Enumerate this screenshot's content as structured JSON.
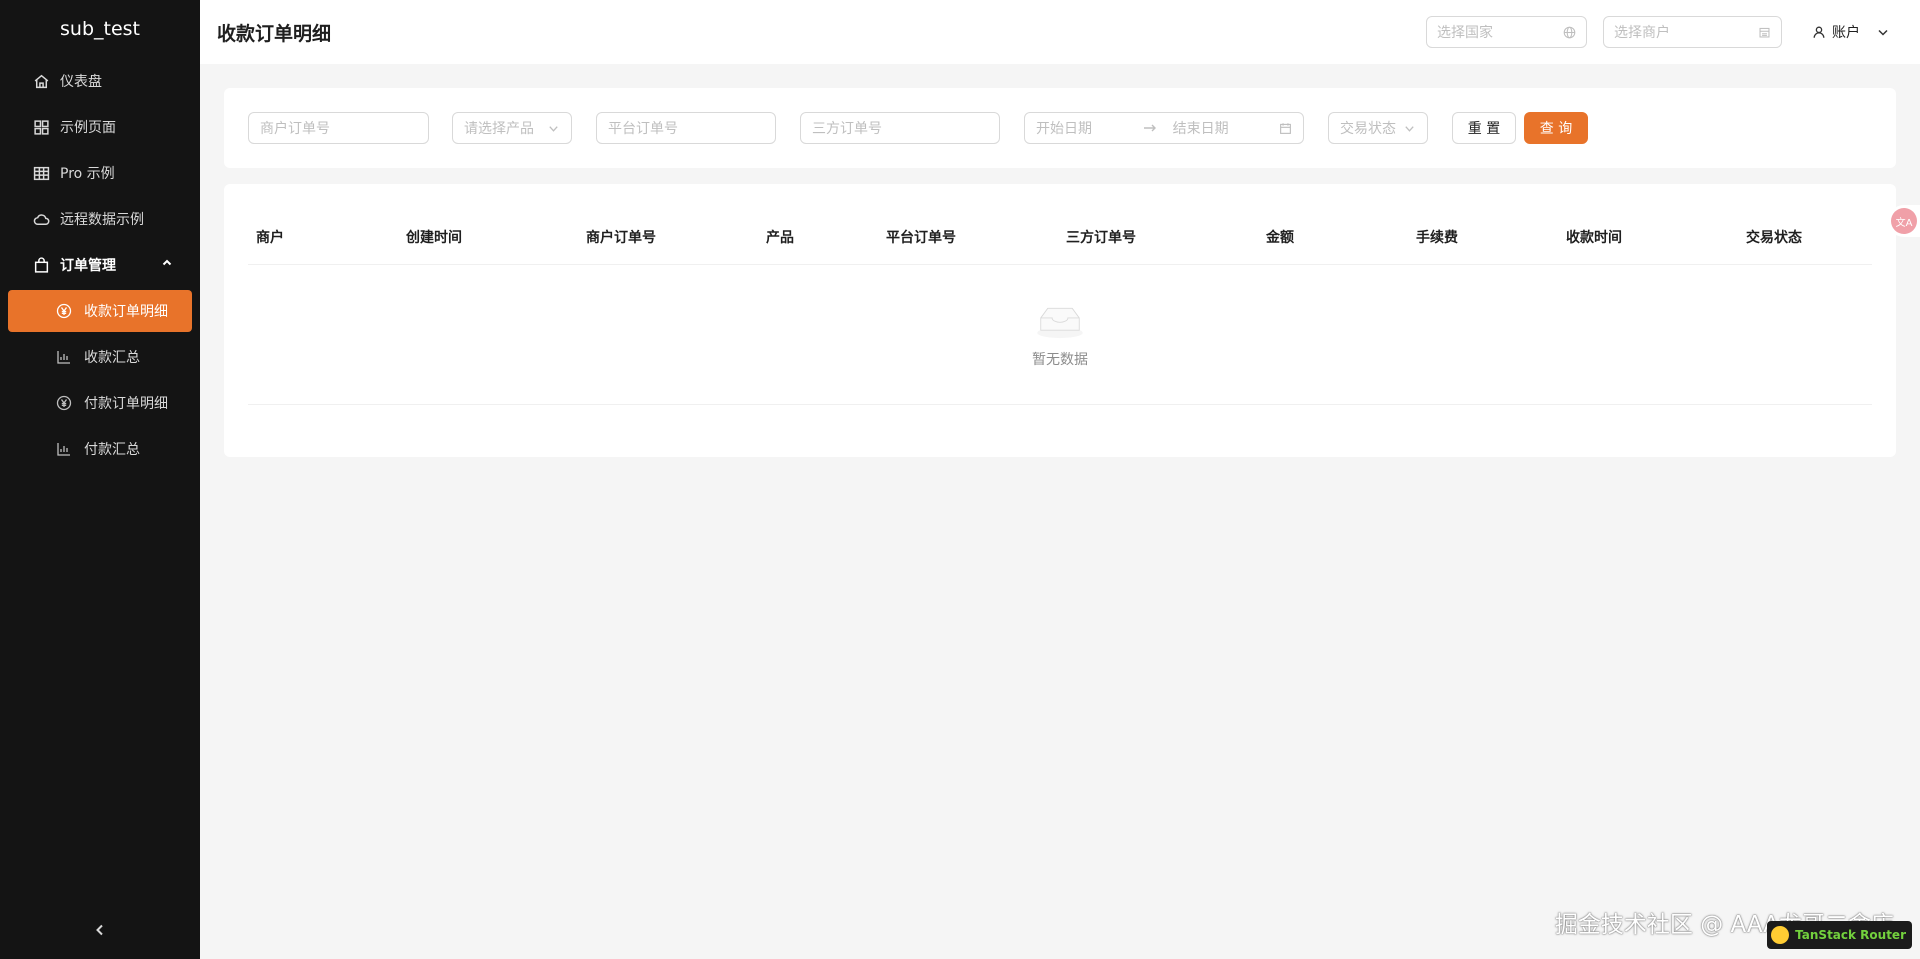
{
  "sidebar": {
    "brand": "sub_test",
    "items": [
      {
        "label": "仪表盘",
        "icon": "home-icon"
      },
      {
        "label": "示例页面",
        "icon": "grid-icon"
      },
      {
        "label": "Pro 示例",
        "icon": "table-icon"
      },
      {
        "label": "远程数据示例",
        "icon": "cloud-icon"
      }
    ],
    "group": {
      "label": "订单管理",
      "icon": "shopping-bag-icon"
    },
    "sub_items": [
      {
        "label": "收款订单明细",
        "icon": "yen-circle-icon",
        "active": true
      },
      {
        "label": "收款汇总",
        "icon": "bar-chart-icon"
      },
      {
        "label": "付款订单明细",
        "icon": "yen-circle-icon"
      },
      {
        "label": "付款汇总",
        "icon": "bar-chart-icon"
      }
    ]
  },
  "header": {
    "title": "收款订单明细",
    "country_placeholder": "选择国家",
    "merchant_placeholder": "选择商户",
    "account_label": "账户"
  },
  "filters": {
    "merchant_order_no": "商户订单号",
    "product": "请选择产品",
    "platform_order_no": "平台订单号",
    "third_party_order_no": "三方订单号",
    "start_date": "开始日期",
    "end_date": "结束日期",
    "trade_status": "交易状态",
    "reset_label": "重 置",
    "query_label": "查 询"
  },
  "table": {
    "columns": [
      "商户",
      "创建时间",
      "商户订单号",
      "产品",
      "平台订单号",
      "三方订单号",
      "金额",
      "手续费",
      "收款时间",
      "交易状态"
    ],
    "empty_text": "暂无数据"
  },
  "watermark": "掘金技术社区 @ AAA龙哥二舍店",
  "router_badge": "TanStack Router",
  "colors": {
    "accent": "#e8732a",
    "sidebar_bg": "#141414"
  }
}
